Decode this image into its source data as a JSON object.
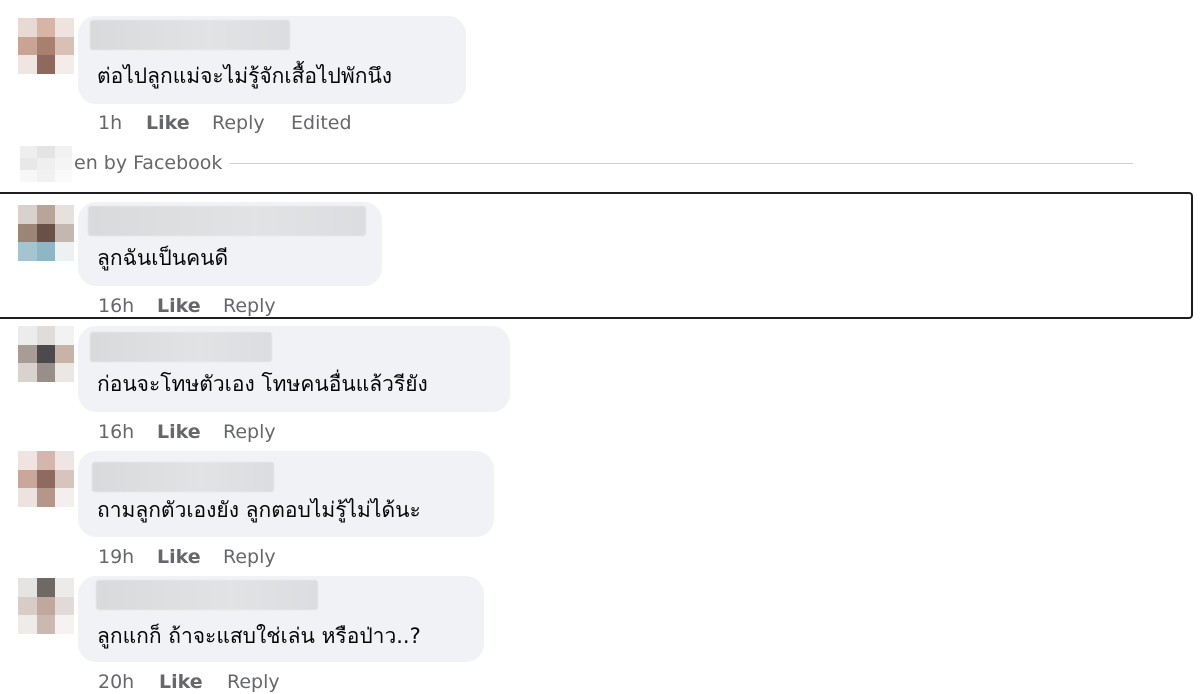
{
  "hidden_by": "en by Facebook",
  "comments": [
    {
      "text": "ต่อไปลูกแม่จะไม่รู้จักเสื้อไปพักนึง",
      "time": "1h",
      "like": "Like",
      "reply": "Reply",
      "edited": "Edited"
    },
    {
      "text": "ลูกฉันเป็นคนดี",
      "time": "16h",
      "like": "Like",
      "reply": "Reply"
    },
    {
      "text": "ก่อนจะโทษตัวเอง โทษคนอื่นแล้วรียัง",
      "time": "16h",
      "like": "Like",
      "reply": "Reply"
    },
    {
      "text": "ถามลูกตัวเองยัง ลูกตอบไม่รู้ไม่ได้นะ",
      "time": "19h",
      "like": "Like",
      "reply": "Reply"
    },
    {
      "text": "ลูกแกก็ ถ้าจะแสบใช่เล่น หรือป่าว..?",
      "time": "20h",
      "like": "Like",
      "reply": "Reply"
    }
  ],
  "colors": {
    "bubble": "#f0f2f5",
    "meta_text": "#65676b",
    "highlight_border": "#1c1e21"
  }
}
